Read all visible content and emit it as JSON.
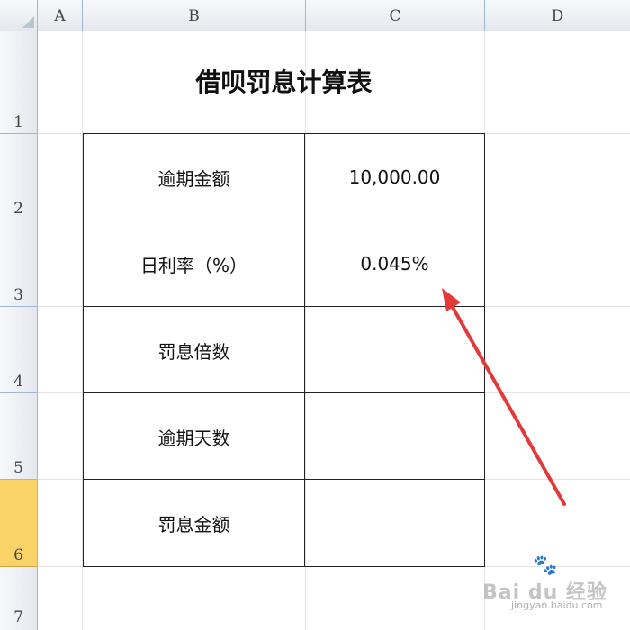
{
  "columns": [
    "A",
    "B",
    "C",
    "D"
  ],
  "rows": [
    "1",
    "2",
    "3",
    "4",
    "5",
    "6",
    "7"
  ],
  "selected_row": "6",
  "title": "借呗罚息计算表",
  "table": [
    {
      "label": "逾期金额",
      "value": "10,000.00"
    },
    {
      "label": "日利率（%）",
      "value": "0.045%"
    },
    {
      "label": "罚息倍数",
      "value": ""
    },
    {
      "label": "逾期天数",
      "value": ""
    },
    {
      "label": "罚息金额",
      "value": ""
    }
  ],
  "watermark": {
    "brand": "Bai du 经验",
    "sub": "jingyan.baidu.com"
  },
  "colors": {
    "header_bg": "#e4e8ee",
    "selected_row": "#f9d367",
    "arrow": "#e23a3a",
    "grid": "#e3e3e3"
  }
}
